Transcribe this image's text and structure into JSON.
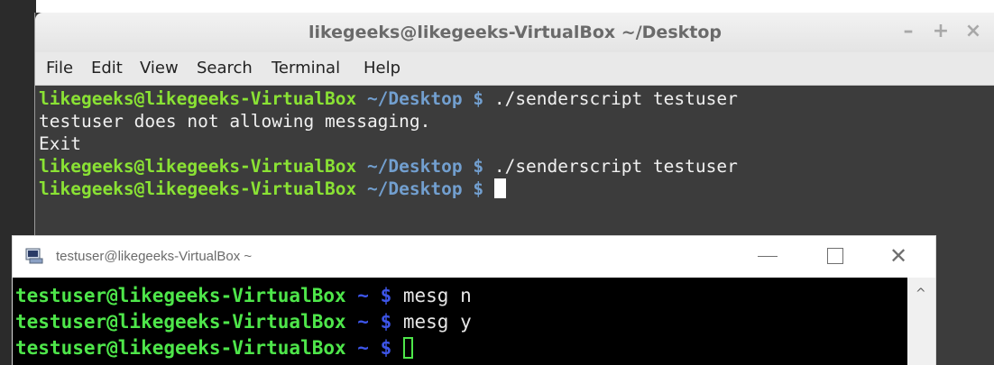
{
  "window1": {
    "title": "likegeeks@likegeeks-VirtualBox ~/Desktop",
    "controls": [
      "–",
      "+",
      "×"
    ],
    "menu": [
      "File",
      "Edit",
      "View",
      "Search",
      "Terminal",
      "Help"
    ],
    "lines": [
      {
        "prompt_user": "likegeeks@likegeeks-VirtualBox",
        "prompt_path": " ~/Desktop $",
        "command": " ./senderscript testuser"
      },
      {
        "output": "testuser does not allowing messaging."
      },
      {
        "output": "Exit"
      },
      {
        "prompt_user": "likegeeks@likegeeks-VirtualBox",
        "prompt_path": " ~/Desktop $",
        "command": " ./senderscript testuser"
      },
      {
        "prompt_user": "likegeeks@likegeeks-VirtualBox",
        "prompt_path": " ~/Desktop $",
        "command": " "
      }
    ]
  },
  "window2": {
    "title": "testuser@likegeeks-VirtualBox ~",
    "lines": [
      {
        "prompt_user": "testuser@likegeeks-VirtualBox",
        "prompt_path": " ~ $",
        "command": " mesg n"
      },
      {
        "prompt_user": "testuser@likegeeks-VirtualBox",
        "prompt_path": " ~ $",
        "command": " mesg y"
      },
      {
        "prompt_user": "testuser@likegeeks-VirtualBox",
        "prompt_path": " ~ $",
        "command": " "
      }
    ],
    "scroll_up_glyph": "^"
  },
  "colors": {
    "term1_bg": "#3c3c3c",
    "term1_user": "#8ae234",
    "term1_path": "#729fcf",
    "term2_bg": "#000000",
    "term2_user": "#4ee64a",
    "term2_path": "#3d55e8"
  }
}
